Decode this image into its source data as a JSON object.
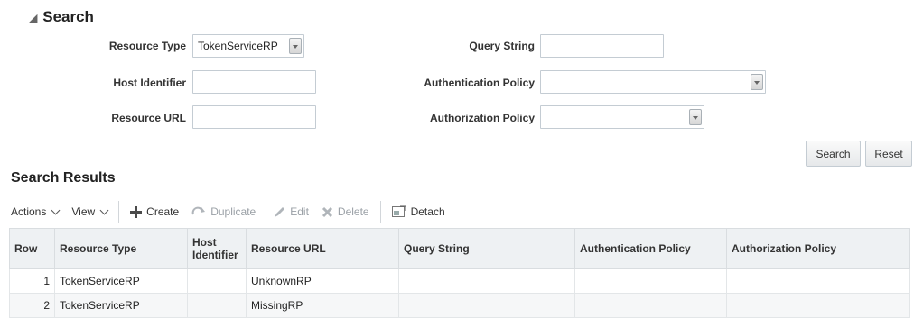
{
  "search": {
    "title": "Search",
    "fields": {
      "resource_type": {
        "label": "Resource Type",
        "value": "TokenServiceRP"
      },
      "query_string": {
        "label": "Query String",
        "value": ""
      },
      "host_identifier": {
        "label": "Host Identifier",
        "value": ""
      },
      "authentication_policy": {
        "label": "Authentication Policy",
        "value": ""
      },
      "resource_url": {
        "label": "Resource URL",
        "value": ""
      },
      "authorization_policy": {
        "label": "Authorization Policy",
        "value": ""
      }
    },
    "search_button": "Search",
    "reset_button": "Reset"
  },
  "results": {
    "title": "Search Results",
    "toolbar": {
      "actions": "Actions",
      "view": "View",
      "create": "Create",
      "duplicate": "Duplicate",
      "edit": "Edit",
      "delete": "Delete",
      "detach": "Detach"
    },
    "columns": [
      "Row",
      "Resource Type",
      "Host Identifier",
      "Resource URL",
      "Query String",
      "Authentication Policy",
      "Authorization Policy"
    ],
    "rows": [
      {
        "row": "1",
        "resource_type": "TokenServiceRP",
        "host_identifier": "",
        "resource_url": "UnknownRP",
        "query_string": "",
        "authentication_policy": "",
        "authorization_policy": ""
      },
      {
        "row": "2",
        "resource_type": "TokenServiceRP",
        "host_identifier": "",
        "resource_url": "MissingRP",
        "query_string": "",
        "authentication_policy": "",
        "authorization_policy": ""
      }
    ]
  },
  "colors": {
    "header_bg": "#eef1f3",
    "border": "#c4ccd3",
    "disabled_text": "#9aa0a6",
    "create_icon": "#4a4a4a"
  }
}
